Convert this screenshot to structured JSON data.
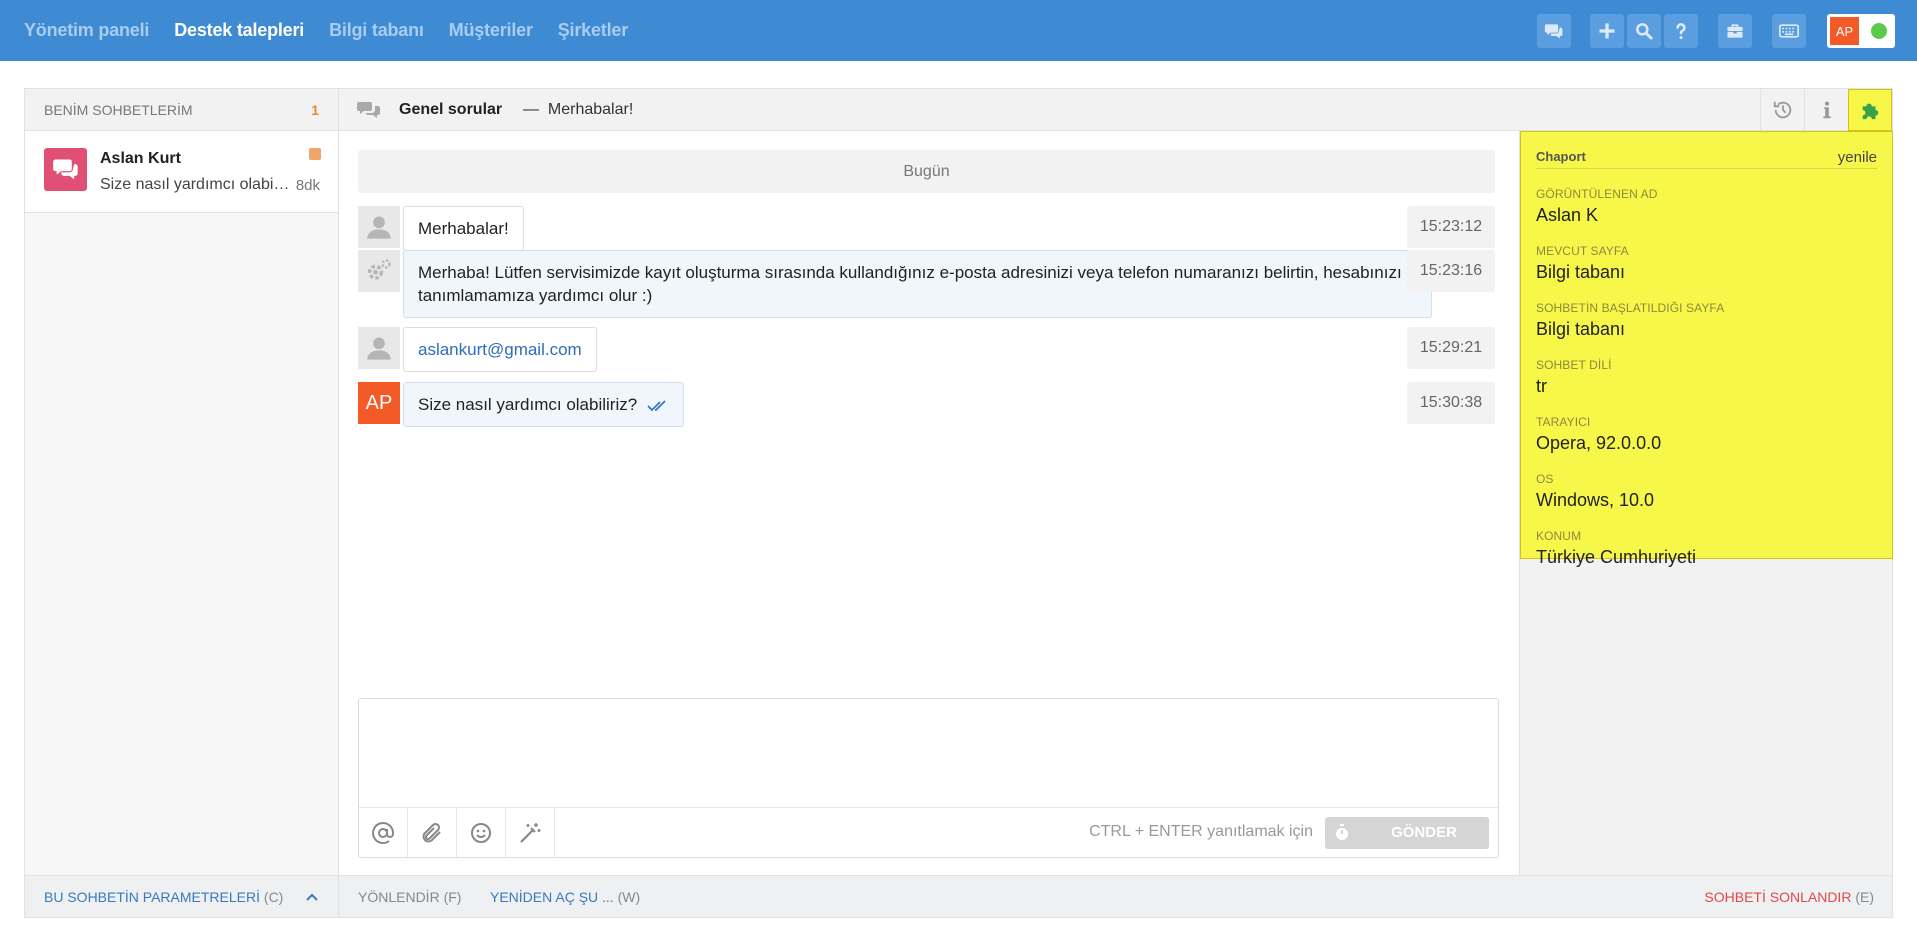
{
  "nav": {
    "items": [
      {
        "label": "Yönetim paneli",
        "active": false
      },
      {
        "label": "Destek talepleri",
        "active": true
      },
      {
        "label": "Bilgi tabanı",
        "active": false
      },
      {
        "label": "Müşteriler",
        "active": false
      },
      {
        "label": "Şirketler",
        "active": false
      }
    ],
    "user_initials": "AP",
    "status_color": "#5cc94b"
  },
  "sidebar": {
    "title": "BENİM SOHBETLERİM",
    "count": "1",
    "chats": [
      {
        "name": "Aslan Kurt",
        "preview": "Size nasıl yardımcı olabiliriz?",
        "time": "8dk"
      }
    ],
    "footer_label": "BU SOHBETİN PARAMETRELERİ",
    "footer_key": "(C)"
  },
  "chat": {
    "topic": "Genel sorular",
    "separator": "—",
    "subject": "Merhabalar!",
    "day_label": "Bugün",
    "messages": [
      {
        "from": "visitor",
        "text": "Merhabalar!",
        "time": "15:23:12"
      },
      {
        "from": "bot",
        "text": "Merhaba! Lütfen servisimizde kayıt oluşturma sırasında kullandığınız e-posta adresinizi veya telefon numaranızı belirtin, hesabınızı tanımlamamıza yardımcı olur :)",
        "time": "15:23:16"
      },
      {
        "from": "visitor",
        "text": "aslankurt@gmail.com",
        "time": "15:29:21"
      },
      {
        "from": "agent",
        "avatar": "AP",
        "text": "Size nasıl yardımcı olabiliriz?",
        "time": "15:30:38"
      }
    ],
    "composer": {
      "hint": "CTRL + ENTER yanıtlamak için",
      "send_label": "GÖNDER"
    },
    "footer": {
      "redirect_label": "YÖNLENDİR",
      "redirect_key": "(F)",
      "reopen_label": "YENİDEN AÇ ŞU ...",
      "reopen_key": "(W)",
      "end_label": "SOHBETİ SONLANDIR",
      "end_key": "(E)"
    }
  },
  "info_panel": {
    "name": "Chaport",
    "refresh": "yenile",
    "fields": [
      {
        "key": "GÖRÜNTÜLENEN AD",
        "value": "Aslan K"
      },
      {
        "key": "MEVCUT SAYFA",
        "value": "Bilgi tabanı"
      },
      {
        "key": "SOHBETİN BAŞLATILDIĞI SAYFA",
        "value": "Bilgi tabanı"
      },
      {
        "key": "SOHBET DİLİ",
        "value": "tr"
      },
      {
        "key": "TARAYICI",
        "value": "Opera, 92.0.0.0"
      },
      {
        "key": "OS",
        "value": "Windows, 10.0"
      },
      {
        "key": "KONUM",
        "value": "Türkiye Cumhuriyeti"
      }
    ]
  },
  "colors": {
    "topbar": "#3e8ad3",
    "accent_orange": "#f35a25",
    "highlight_yellow": "#f7f74a",
    "chat_icon_pink": "#e05075",
    "end_red": "#e04a4a"
  }
}
